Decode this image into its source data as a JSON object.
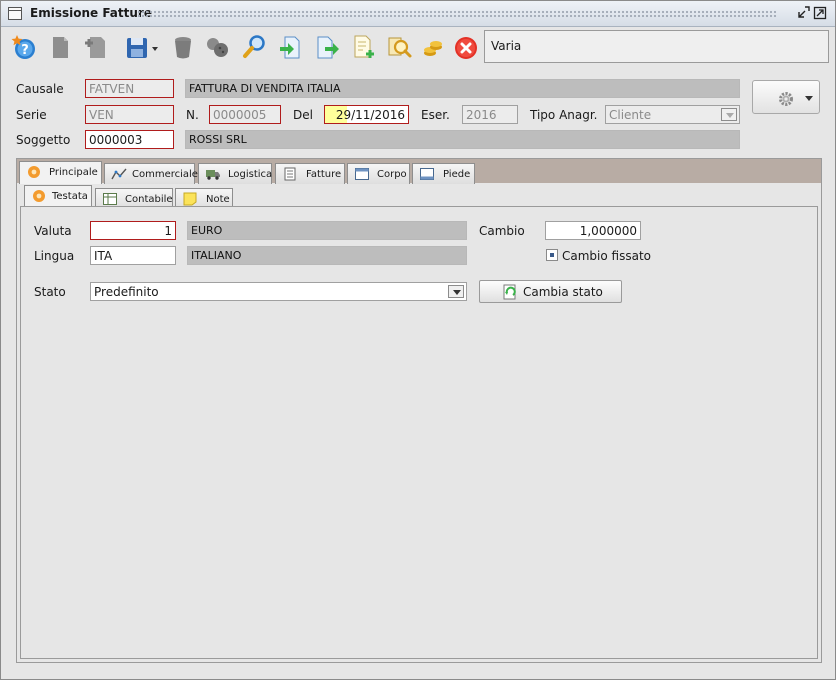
{
  "window": {
    "title": "Emissione Fatture"
  },
  "toolbar": {
    "icons": [
      "help-star-icon",
      "document-icon",
      "new-document-icon",
      "save-floppy-icon",
      "trash-icon",
      "cookies-icon",
      "search-magnifier-icon",
      "import-arrow-icon",
      "export-arrow-icon",
      "add-document-icon",
      "find-user-icon",
      "coins-icon",
      "close-circle-icon"
    ],
    "varia_label": "Varia"
  },
  "header": {
    "causale_label": "Causale",
    "causale_code": "FATVEN",
    "causale_desc": "FATTURA DI VENDITA ITALIA",
    "serie_label": "Serie",
    "serie_code": "VEN",
    "numero_label": "N.",
    "numero_value": "0000005",
    "del_label": "Del",
    "del_value": "29/11/2016",
    "eser_label": "Eser.",
    "eser_value": "2016",
    "tipo_anagr_label": "Tipo Anagr.",
    "tipo_anagr_value": "Cliente",
    "soggetto_label": "Soggetto",
    "soggetto_code": "0000003",
    "soggetto_desc": "ROSSI SRL"
  },
  "tabs_main": [
    {
      "label": "Principale",
      "icon": "asterisk-icon",
      "active": true
    },
    {
      "label": "Commerciale",
      "icon": "chart-line-icon"
    },
    {
      "label": "Logistica",
      "icon": "truck-icon"
    },
    {
      "label": "Fatture",
      "icon": "list-icon"
    },
    {
      "label": "Corpo",
      "icon": "window-icon"
    },
    {
      "label": "Piede",
      "icon": "window-footer-icon"
    }
  ],
  "tabs_sub": [
    {
      "label": "Testata",
      "icon": "asterisk-icon",
      "active": true
    },
    {
      "label": "Contabile",
      "icon": "table-icon"
    },
    {
      "label": "Note",
      "icon": "note-icon"
    }
  ],
  "testata": {
    "valuta_label": "Valuta",
    "valuta_code": "1",
    "valuta_desc": "EURO",
    "cambio_label": "Cambio",
    "cambio_value": "1,000000",
    "lingua_label": "Lingua",
    "lingua_code": "ITA",
    "lingua_desc": "ITALIANO",
    "cambio_fissato_label": "Cambio fissato",
    "stato_label": "Stato",
    "stato_value": "Predefinito",
    "cambia_stato_label": "Cambia stato"
  },
  "colors": {
    "required_border": "#b01c1c",
    "tab_strip": "#b8aca4",
    "date_highlight": "#ffff9b"
  }
}
